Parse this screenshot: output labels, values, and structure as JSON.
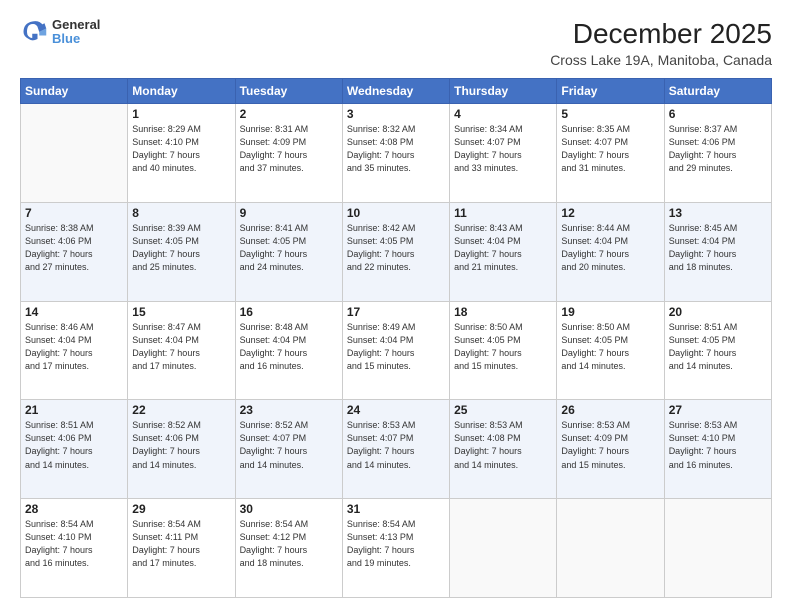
{
  "logo": {
    "line1": "General",
    "line2": "Blue"
  },
  "title": "December 2025",
  "subtitle": "Cross Lake 19A, Manitoba, Canada",
  "days_of_week": [
    "Sunday",
    "Monday",
    "Tuesday",
    "Wednesday",
    "Thursday",
    "Friday",
    "Saturday"
  ],
  "weeks": [
    [
      {
        "num": "",
        "info": ""
      },
      {
        "num": "1",
        "info": "Sunrise: 8:29 AM\nSunset: 4:10 PM\nDaylight: 7 hours\nand 40 minutes."
      },
      {
        "num": "2",
        "info": "Sunrise: 8:31 AM\nSunset: 4:09 PM\nDaylight: 7 hours\nand 37 minutes."
      },
      {
        "num": "3",
        "info": "Sunrise: 8:32 AM\nSunset: 4:08 PM\nDaylight: 7 hours\nand 35 minutes."
      },
      {
        "num": "4",
        "info": "Sunrise: 8:34 AM\nSunset: 4:07 PM\nDaylight: 7 hours\nand 33 minutes."
      },
      {
        "num": "5",
        "info": "Sunrise: 8:35 AM\nSunset: 4:07 PM\nDaylight: 7 hours\nand 31 minutes."
      },
      {
        "num": "6",
        "info": "Sunrise: 8:37 AM\nSunset: 4:06 PM\nDaylight: 7 hours\nand 29 minutes."
      }
    ],
    [
      {
        "num": "7",
        "info": "Sunrise: 8:38 AM\nSunset: 4:06 PM\nDaylight: 7 hours\nand 27 minutes."
      },
      {
        "num": "8",
        "info": "Sunrise: 8:39 AM\nSunset: 4:05 PM\nDaylight: 7 hours\nand 25 minutes."
      },
      {
        "num": "9",
        "info": "Sunrise: 8:41 AM\nSunset: 4:05 PM\nDaylight: 7 hours\nand 24 minutes."
      },
      {
        "num": "10",
        "info": "Sunrise: 8:42 AM\nSunset: 4:05 PM\nDaylight: 7 hours\nand 22 minutes."
      },
      {
        "num": "11",
        "info": "Sunrise: 8:43 AM\nSunset: 4:04 PM\nDaylight: 7 hours\nand 21 minutes."
      },
      {
        "num": "12",
        "info": "Sunrise: 8:44 AM\nSunset: 4:04 PM\nDaylight: 7 hours\nand 20 minutes."
      },
      {
        "num": "13",
        "info": "Sunrise: 8:45 AM\nSunset: 4:04 PM\nDaylight: 7 hours\nand 18 minutes."
      }
    ],
    [
      {
        "num": "14",
        "info": "Sunrise: 8:46 AM\nSunset: 4:04 PM\nDaylight: 7 hours\nand 17 minutes."
      },
      {
        "num": "15",
        "info": "Sunrise: 8:47 AM\nSunset: 4:04 PM\nDaylight: 7 hours\nand 17 minutes."
      },
      {
        "num": "16",
        "info": "Sunrise: 8:48 AM\nSunset: 4:04 PM\nDaylight: 7 hours\nand 16 minutes."
      },
      {
        "num": "17",
        "info": "Sunrise: 8:49 AM\nSunset: 4:04 PM\nDaylight: 7 hours\nand 15 minutes."
      },
      {
        "num": "18",
        "info": "Sunrise: 8:50 AM\nSunset: 4:05 PM\nDaylight: 7 hours\nand 15 minutes."
      },
      {
        "num": "19",
        "info": "Sunrise: 8:50 AM\nSunset: 4:05 PM\nDaylight: 7 hours\nand 14 minutes."
      },
      {
        "num": "20",
        "info": "Sunrise: 8:51 AM\nSunset: 4:05 PM\nDaylight: 7 hours\nand 14 minutes."
      }
    ],
    [
      {
        "num": "21",
        "info": "Sunrise: 8:51 AM\nSunset: 4:06 PM\nDaylight: 7 hours\nand 14 minutes."
      },
      {
        "num": "22",
        "info": "Sunrise: 8:52 AM\nSunset: 4:06 PM\nDaylight: 7 hours\nand 14 minutes."
      },
      {
        "num": "23",
        "info": "Sunrise: 8:52 AM\nSunset: 4:07 PM\nDaylight: 7 hours\nand 14 minutes."
      },
      {
        "num": "24",
        "info": "Sunrise: 8:53 AM\nSunset: 4:07 PM\nDaylight: 7 hours\nand 14 minutes."
      },
      {
        "num": "25",
        "info": "Sunrise: 8:53 AM\nSunset: 4:08 PM\nDaylight: 7 hours\nand 14 minutes."
      },
      {
        "num": "26",
        "info": "Sunrise: 8:53 AM\nSunset: 4:09 PM\nDaylight: 7 hours\nand 15 minutes."
      },
      {
        "num": "27",
        "info": "Sunrise: 8:53 AM\nSunset: 4:10 PM\nDaylight: 7 hours\nand 16 minutes."
      }
    ],
    [
      {
        "num": "28",
        "info": "Sunrise: 8:54 AM\nSunset: 4:10 PM\nDaylight: 7 hours\nand 16 minutes."
      },
      {
        "num": "29",
        "info": "Sunrise: 8:54 AM\nSunset: 4:11 PM\nDaylight: 7 hours\nand 17 minutes."
      },
      {
        "num": "30",
        "info": "Sunrise: 8:54 AM\nSunset: 4:12 PM\nDaylight: 7 hours\nand 18 minutes."
      },
      {
        "num": "31",
        "info": "Sunrise: 8:54 AM\nSunset: 4:13 PM\nDaylight: 7 hours\nand 19 minutes."
      },
      {
        "num": "",
        "info": ""
      },
      {
        "num": "",
        "info": ""
      },
      {
        "num": "",
        "info": ""
      }
    ]
  ]
}
